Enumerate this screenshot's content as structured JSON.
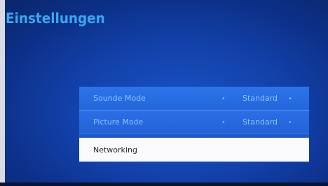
{
  "screen": {
    "title": "Einstellungen"
  },
  "menu": {
    "items": [
      {
        "label": "Sounde Mode",
        "value": "Standard",
        "arrow_left": "◂",
        "arrow_right": "▸"
      },
      {
        "label": "Picture Mode",
        "value": "Standard",
        "arrow_left": "◂",
        "arrow_right": "▸"
      },
      {
        "label": "Networking"
      }
    ]
  },
  "colors": {
    "background": "#1240a8",
    "title": "#38a8ee",
    "menu_row": "#2466db",
    "menu_text": "#8ec2ff",
    "selected_row": "#fbfbfd",
    "selected_text": "#2a2a2a"
  }
}
